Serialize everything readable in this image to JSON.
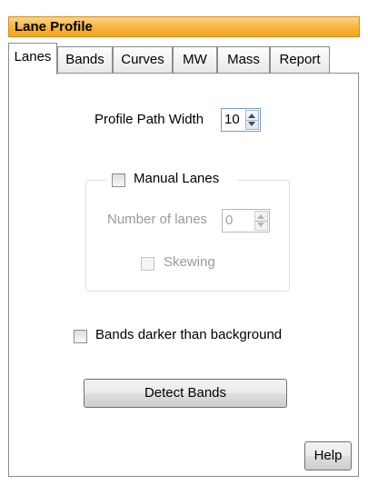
{
  "title": "Lane Profile",
  "tabs": [
    {
      "label": "Lanes",
      "active": true
    },
    {
      "label": "Bands"
    },
    {
      "label": "Curves"
    },
    {
      "label": "MW"
    },
    {
      "label": "Mass"
    },
    {
      "label": "Report"
    }
  ],
  "lanes_tab": {
    "profile_path_width_label": "Profile Path Width",
    "profile_path_width_value": "10",
    "manual_lanes": {
      "label": "Manual Lanes",
      "checked": false
    },
    "number_of_lanes_label": "Number of lanes",
    "number_of_lanes_value": "0",
    "skewing": {
      "label": "Skewing",
      "checked": false
    },
    "bands_darker": {
      "label": "Bands darker than background",
      "checked": false
    },
    "detect_bands_label": "Detect Bands",
    "help_label": "Help"
  },
  "colors": {
    "title_bar": "#f7b43a",
    "input_border": "#7a9cc6",
    "disabled_text": "#9a9a9a"
  }
}
